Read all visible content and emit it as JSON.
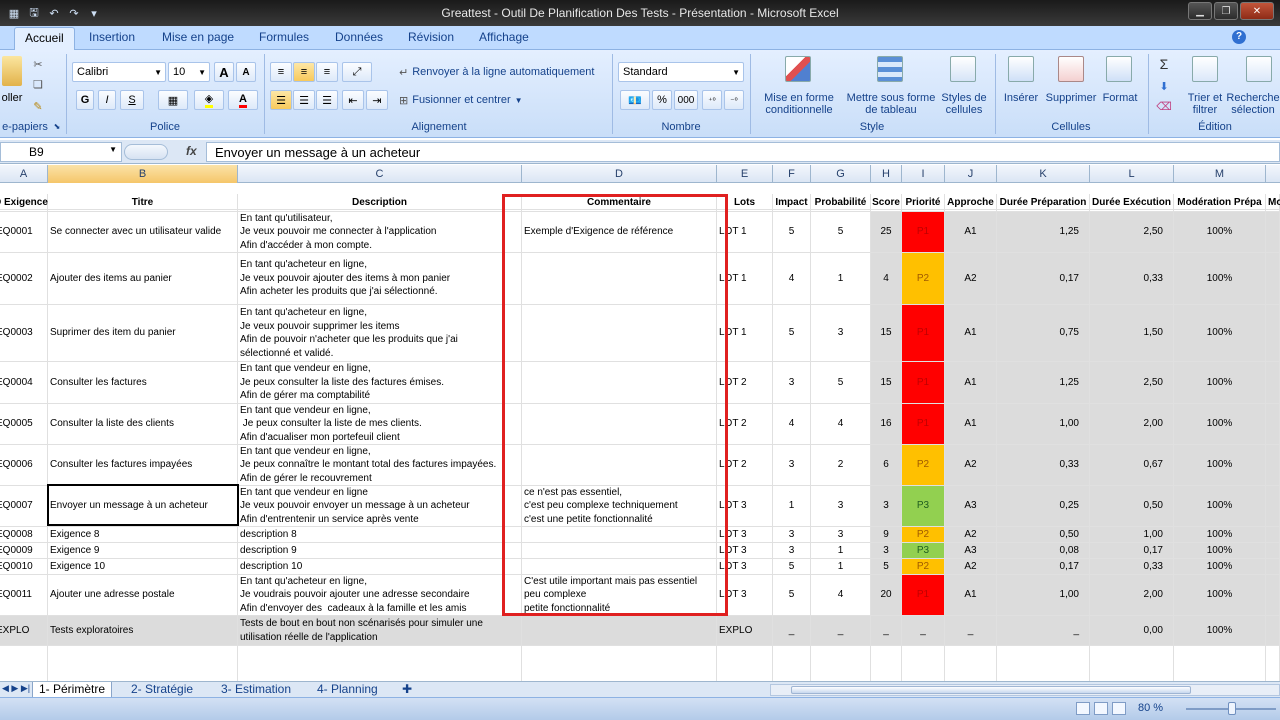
{
  "window": {
    "title": "Greattest - Outil De Planification Des Tests - Présentation - Microsoft Excel"
  },
  "ribbon": {
    "tabs": [
      "Accueil",
      "Insertion",
      "Mise en page",
      "Formules",
      "Données",
      "Révision",
      "Affichage"
    ],
    "active_tab": "Accueil",
    "help_label": "?",
    "clipboard": {
      "paste_label": "oller",
      "group_label": "e-papiers"
    },
    "police": {
      "font_name": "Calibri",
      "font_size": "10",
      "bold": "G",
      "italic": "I",
      "underline": "S",
      "grow": "A",
      "shrink": "A",
      "font_color": "A",
      "group_label": "Police"
    },
    "alignement": {
      "wrap_label": "Renvoyer à la ligne automatiquement",
      "merge_label": "Fusionner et centrer",
      "group_label": "Alignement"
    },
    "nombre": {
      "format_value": "Standard",
      "percent": "%",
      "thousands": "000",
      "group_label": "Nombre"
    },
    "style": {
      "cond_format": "Mise en forme conditionnelle",
      "table_format": "Mettre sous forme de tableau",
      "cell_styles": "Styles de cellules",
      "group_label": "Style"
    },
    "cellules": {
      "insert": "Insérer",
      "delete": "Supprimer",
      "format": "Format",
      "group_label": "Cellules"
    },
    "edition": {
      "sort": "Trier et filtrer",
      "find": "Recherche sélection",
      "group_label": "Édition"
    }
  },
  "formula_bar": {
    "name_box": "B9",
    "fx": "fx",
    "content": "Envoyer un message à un acheteur"
  },
  "columns": [
    "A",
    "B",
    "C",
    "D",
    "E",
    "F",
    "G",
    "H",
    "I",
    "J",
    "K",
    "L",
    "M"
  ],
  "selected_column": "B",
  "header_row": [
    "D Exigence",
    "Titre",
    "Description",
    "Commentaire",
    "Lots",
    "Impact",
    "Probabilité",
    "Score",
    "Priorité",
    "Approche",
    "Durée Préparation",
    "Durée Exécution",
    "Modération Prépa",
    "Mo"
  ],
  "rows": [
    {
      "id": "EQ0001",
      "titre": "Se connecter avec un utilisateur valide",
      "desc": "En tant qu'utilisateur,\nJe veux pouvoir me connecter à l'application\nAfin d'accéder à mon compte.",
      "comment": "Exemple d'Exigence de référence",
      "lot": "LOT 1",
      "impact": "5",
      "prob": "5",
      "score": "25",
      "prio": "P1",
      "appr": "A1",
      "prep": "1,25",
      "exec": "2,50",
      "mod": "100%"
    },
    {
      "id": "EQ0002",
      "titre": "Ajouter des items au panier",
      "desc": "En tant qu'acheteur en ligne,\nJe veux pouvoir ajouter des items à mon panier\nAfin acheter les produits que j'ai sélectionné.",
      "comment": "",
      "lot": "LOT 1",
      "impact": "4",
      "prob": "1",
      "score": "4",
      "prio": "P2",
      "appr": "A2",
      "prep": "0,17",
      "exec": "0,33",
      "mod": "100%"
    },
    {
      "id": "EQ0003",
      "titre": "Suprimer des item du panier",
      "desc": "En tant qu'acheteur en ligne,\nJe veux pouvoir supprimer les items\nAfin de pouvoir n'acheter que les produits que j'ai\nsélectionné et validé.",
      "comment": "",
      "lot": "LOT 1",
      "impact": "5",
      "prob": "3",
      "score": "15",
      "prio": "P1",
      "appr": "A1",
      "prep": "0,75",
      "exec": "1,50",
      "mod": "100%"
    },
    {
      "id": "EQ0004",
      "titre": "Consulter les factures",
      "desc": "En tant que vendeur en ligne,\nJe peux consulter la liste des factures émises.\nAfin de gérer ma comptabilité",
      "comment": "",
      "lot": "LOT 2",
      "impact": "3",
      "prob": "5",
      "score": "15",
      "prio": "P1",
      "appr": "A1",
      "prep": "1,25",
      "exec": "2,50",
      "mod": "100%"
    },
    {
      "id": "EQ0005",
      "titre": "Consulter la liste des clients",
      "desc": "En tant que vendeur en ligne,\n Je peux consulter la liste de mes clients.\nAfin d'acualiser mon portefeuil client",
      "comment": "",
      "lot": "LOT 2",
      "impact": "4",
      "prob": "4",
      "score": "16",
      "prio": "P1",
      "appr": "A1",
      "prep": "1,00",
      "exec": "2,00",
      "mod": "100%"
    },
    {
      "id": "EQ0006",
      "titre": "Consulter les factures impayées",
      "desc": "En tant que vendeur en ligne,\nJe peux connaître le montant total des factures impayées.\nAfin de gérer le recouvrement",
      "comment": "",
      "lot": "LOT 2",
      "impact": "3",
      "prob": "2",
      "score": "6",
      "prio": "P2",
      "appr": "A2",
      "prep": "0,33",
      "exec": "0,67",
      "mod": "100%"
    },
    {
      "id": "EQ0007",
      "titre": "Envoyer un message à un acheteur",
      "desc": "En tant que vendeur en ligne\nJe veux pouvoir envoyer un message à un acheteur\nAfin d'entrentenir un service après vente",
      "comment": "ce n'est pas essentiel,\nc'est peu complexe techniquement\nc'est une petite fonctionnalité",
      "lot": "LOT 3",
      "impact": "1",
      "prob": "3",
      "score": "3",
      "prio": "P3",
      "appr": "A3",
      "prep": "0,25",
      "exec": "0,50",
      "mod": "100%"
    },
    {
      "id": "EQ0008",
      "titre": "Exigence 8",
      "desc": "description 8",
      "comment": "",
      "lot": "LOT 3",
      "impact": "3",
      "prob": "3",
      "score": "9",
      "prio": "P2",
      "appr": "A2",
      "prep": "0,50",
      "exec": "1,00",
      "mod": "100%"
    },
    {
      "id": "EQ0009",
      "titre": "Exigence 9",
      "desc": "description 9",
      "comment": "",
      "lot": "LOT 3",
      "impact": "3",
      "prob": "1",
      "score": "3",
      "prio": "P3",
      "appr": "A3",
      "prep": "0,08",
      "exec": "0,17",
      "mod": "100%"
    },
    {
      "id": "EQ0010",
      "titre": "Exigence 10",
      "desc": "description 10",
      "comment": "",
      "lot": "LOT 3",
      "impact": "5",
      "prob": "1",
      "score": "5",
      "prio": "P2",
      "appr": "A2",
      "prep": "0,17",
      "exec": "0,33",
      "mod": "100%"
    },
    {
      "id": "EQ0011",
      "titre": "Ajouter une adresse postale",
      "desc": "En tant qu'acheteur en ligne,\nJe voudrais pouvoir ajouter une adresse secondaire\nAfin d'envoyer des  cadeaux à la famille et les amis",
      "comment": "C'est utile important mais pas essentiel\npeu complexe\npetite fonctionnalité",
      "lot": "LOT 3",
      "impact": "5",
      "prob": "4",
      "score": "20",
      "prio": "P1",
      "appr": "A1",
      "prep": "1,00",
      "exec": "2,00",
      "mod": "100%"
    },
    {
      "id": "EXPLO",
      "titre": "Tests exploratoires",
      "desc": "Tests de bout en bout non scénarisés pour simuler une\nutilisation réelle de l'application",
      "comment": "",
      "lot": "EXPLO",
      "impact": "_",
      "prob": "_",
      "score": "_",
      "prio": "_",
      "appr": "_",
      "prep": "_",
      "exec": "0,00",
      "mod": "100%"
    }
  ],
  "priority_colors": {
    "P1": "#ff0000",
    "P2": "#ffc000",
    "P3": "#92d050"
  },
  "sheet_tabs": [
    "1- Périmètre",
    "2- Stratégie",
    "3- Estimation",
    "4- Planning"
  ],
  "active_sheet": "1- Périmètre",
  "status": {
    "zoom": "80 %"
  }
}
